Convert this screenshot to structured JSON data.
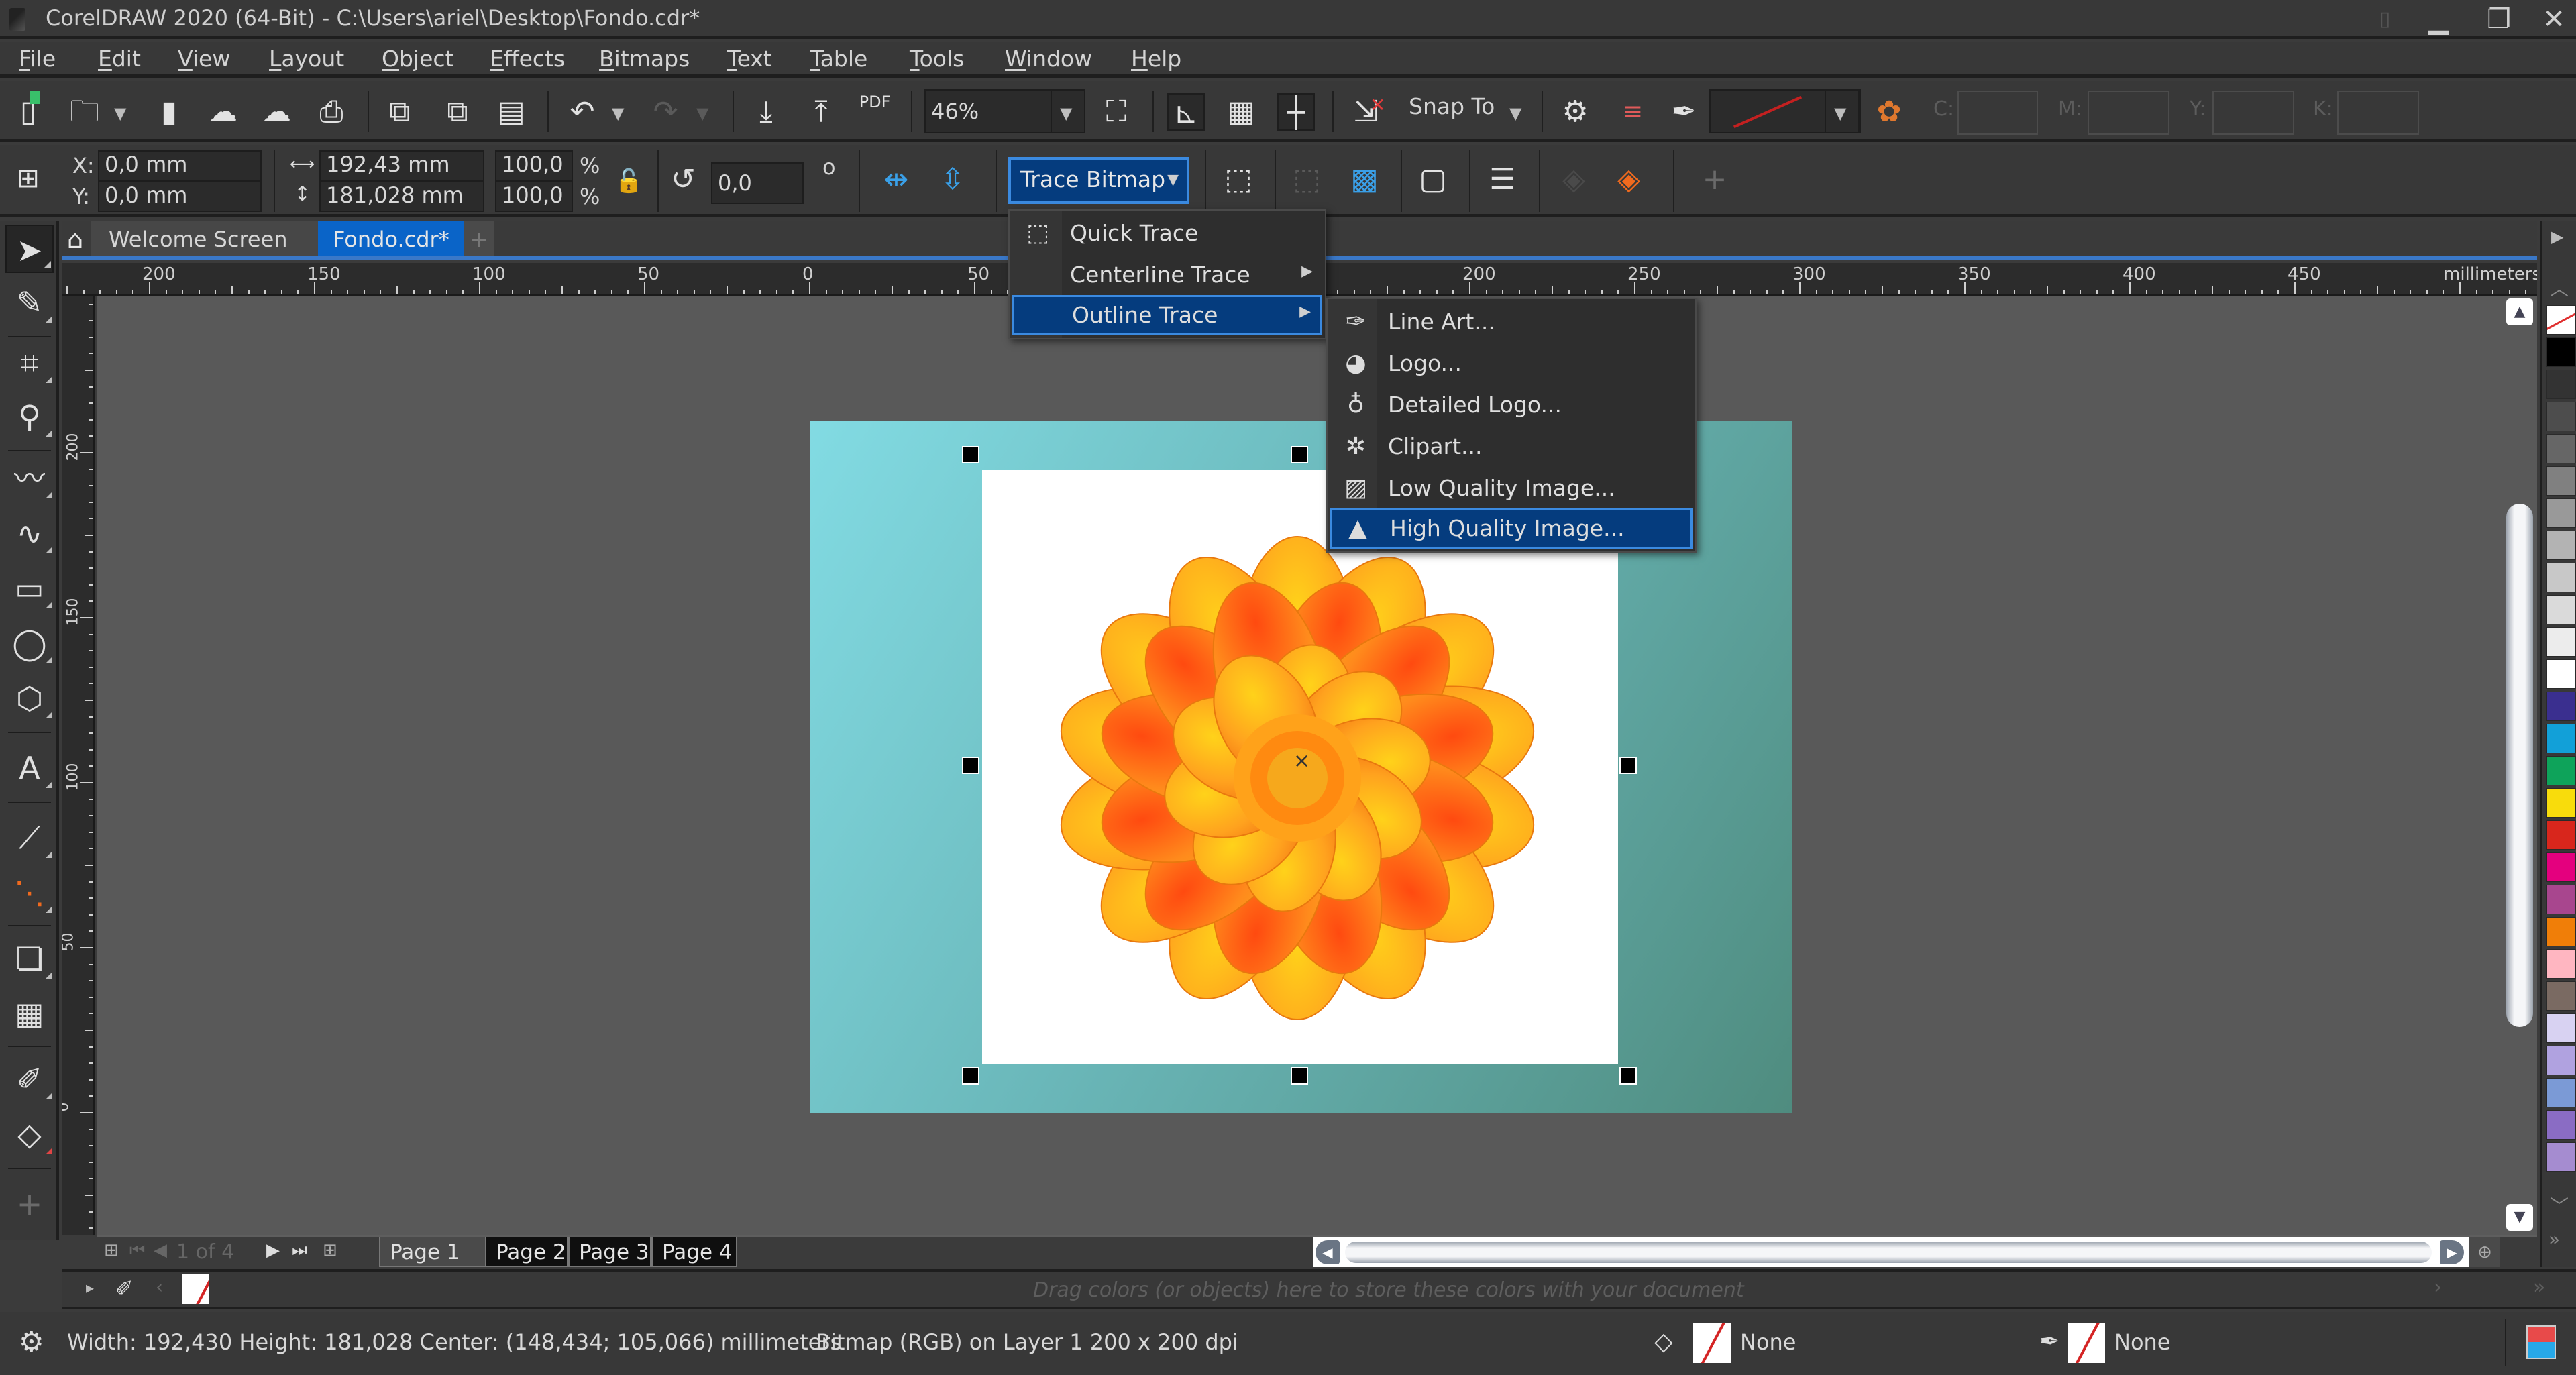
{
  "window": {
    "title": "CorelDRAW 2020 (64-Bit) - C:\\Users\\ariel\\Desktop\\Fondo.cdr*",
    "controls": {
      "minimize": "minimize-icon",
      "restore": "restore-icon",
      "close": "close-icon"
    }
  },
  "menubar": {
    "items": [
      {
        "label": "File",
        "icon": ""
      },
      {
        "label": "Edit"
      },
      {
        "label": "View"
      },
      {
        "label": "Layout"
      },
      {
        "label": "Object"
      },
      {
        "label": "Effects"
      },
      {
        "label": "Bitmaps"
      },
      {
        "label": "Text"
      },
      {
        "label": "Table"
      },
      {
        "label": "Tools"
      },
      {
        "label": "Window"
      },
      {
        "label": "Help"
      }
    ]
  },
  "toolbar": {
    "zoom_value": "46%",
    "snap_to_label": "Snap To",
    "pdf_label": "PDF",
    "cmyk_labels": [
      "C:",
      "M:",
      "Y:",
      "K:"
    ],
    "outline_color": "#d42424"
  },
  "propbar": {
    "x_label": "X:",
    "x_value": "0,0 mm",
    "y_label": "Y:",
    "y_value": "0,0 mm",
    "width_value": "192,43 mm",
    "height_value": "181,028 mm",
    "scale_x": "100,0",
    "scale_y": "100,0",
    "percent": "%",
    "rotation": "0,0",
    "degree_symbol": "o",
    "trace_bitmap_label": "Trace Bitmap"
  },
  "trace_menu": {
    "items": [
      {
        "label": "Quick Trace",
        "has_submenu": false
      },
      {
        "label": "Centerline Trace",
        "has_submenu": true
      },
      {
        "label": "Outline Trace",
        "has_submenu": true,
        "highlighted": true
      }
    ],
    "submenu_arrow": "▶"
  },
  "outline_submenu": {
    "items": [
      {
        "label": "Line Art...",
        "icon": "line-art-icon"
      },
      {
        "label": "Logo...",
        "icon": "logo-icon"
      },
      {
        "label": "Detailed Logo...",
        "icon": "detailed-logo-icon"
      },
      {
        "label": "Clipart...",
        "icon": "clipart-icon"
      },
      {
        "label": "Low Quality Image...",
        "icon": "low-quality-image-icon"
      },
      {
        "label": "High Quality Image...",
        "icon": "high-quality-image-icon",
        "highlighted": true
      }
    ]
  },
  "doc_tabs": {
    "welcome": "Welcome Screen",
    "active": "Fondo.cdr*",
    "add": "+"
  },
  "ruler": {
    "unit": "millimeters",
    "top_labels": [
      "200",
      "150",
      "100",
      "50",
      "0",
      "50",
      "200",
      "250",
      "300",
      "350",
      "400",
      "450"
    ],
    "left_labels": [
      "200",
      "150",
      "100",
      "50",
      "0"
    ]
  },
  "page_nav": {
    "counter": "1 of 4",
    "pages": [
      "Page 1",
      "Page 2",
      "Page 3",
      "Page 4"
    ],
    "active_page": "Page 1"
  },
  "color_docker": {
    "hint": "Drag colors (or objects) here to store these colors with your document"
  },
  "palette": {
    "colors": [
      "none",
      "#000000",
      "#333333",
      "#4d4d4d",
      "#666666",
      "#808080",
      "#999999",
      "#b3b3b3",
      "#c8c8c8",
      "#dadada",
      "#ececec",
      "#ffffff",
      "#3a2f8f",
      "#12a0d8",
      "#0ea35a",
      "#f8dc0c",
      "#d8261c",
      "#e4007e",
      "#a8468e",
      "#f07e08",
      "#ffb6c1",
      "#7a6a62",
      "#d8d2f2",
      "#b0a2e0",
      "#7b9ad6",
      "#8a6cc4",
      "#a58cd0"
    ]
  },
  "statusbar": {
    "info": "Width: 192,430  Height: 181,028  Center: (148,434; 105,066)  millimeters",
    "object": "Bitmap (RGB) on Layer 1 200 x 200 dpi",
    "fill_label": "None",
    "outline_label": "None"
  }
}
